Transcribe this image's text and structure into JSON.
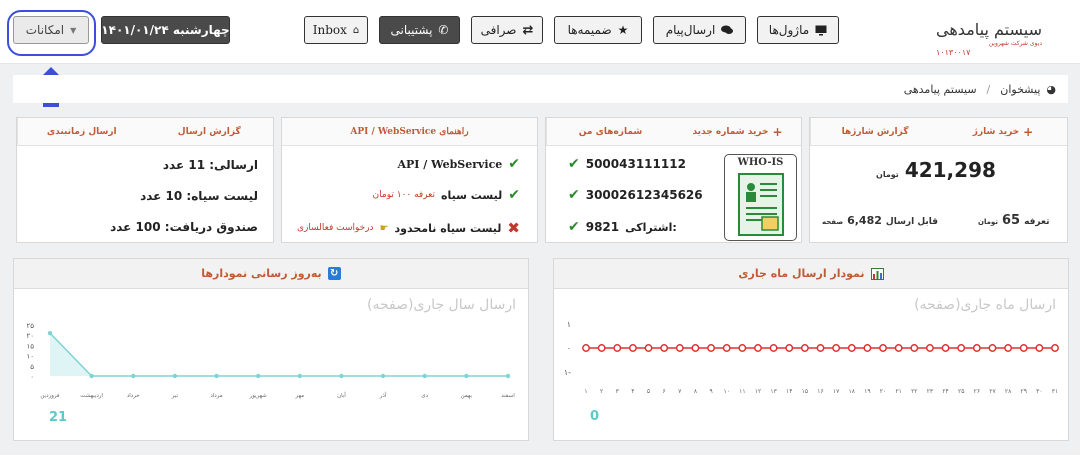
{
  "brand": {
    "title": "سیستم پیامدهی",
    "subtitle": "دیوی شرکت شهروین",
    "code": "۱۰۱۳۰۰۱۷"
  },
  "toolbar": {
    "modules": "ماژول‌ها",
    "send_message": "ارسال‌پیام",
    "attachments": "ضمیمه‌ها",
    "exchange": "صرافی",
    "support": "پشتیبانی",
    "inbox": "Inbox",
    "date": "چهارشنبه ۱۴۰۱/۰۱/۲۴",
    "features": "امکانات"
  },
  "breadcrumb": {
    "home": "پیشخوان",
    "separator": "/",
    "current": "سیستم پیامدهی"
  },
  "charge_card": {
    "tab_buy": "خرید شارژ",
    "tab_report": "گزارش شارژها",
    "balance": "421,298",
    "balance_unit": "تومان",
    "tariff_label": "تعرفه",
    "tariff_value": "65",
    "tariff_unit": "تومان",
    "sendable_label": "قابل ارسال",
    "sendable_value": "6,482",
    "sendable_unit": "صفحه"
  },
  "numbers_card": {
    "tab_buy": "خرید شماره جدید",
    "tab_mine": "شماره‌های من",
    "whois": "WHO-IS",
    "numbers": [
      "500043111112",
      "30002612345626"
    ],
    "shared_label": "اشتراکی:",
    "shared_value": "9821"
  },
  "api_card": {
    "tab": "API / WebService راهنمای",
    "items": [
      "API / WebService",
      "لیست سیاه",
      "لیست سیاه نامحدود"
    ],
    "blacklist_tariff": "تعرفه ۱۰۰ تومان",
    "unlimited_request": "درخواست فعالسازی"
  },
  "report_card": {
    "tab_send": "گزارش ارسال",
    "tab_scheduled": "ارسال زمانبندی",
    "lines": [
      "ارسالی: 11 عدد",
      "لیست سیاه: 10 عدد",
      "صندوق دریافت: 100 عدد"
    ]
  },
  "month_panel": {
    "header": "نمودار ارسال ماه جاری",
    "title": "ارسال ماه جاری(صفحه)",
    "total": "0"
  },
  "year_panel": {
    "header": "به‌روز رسانی نمودارها",
    "title": "ارسال سال جاری(صفحه)",
    "total": "21"
  },
  "colors": {
    "accent": "#c05b35",
    "month_line": "#e03030",
    "year_line": "#7fd3d3",
    "highlight": "#3b4fd8"
  },
  "chart_data": [
    {
      "type": "line",
      "title": "ارسال ماه جاری(صفحه)",
      "x": [
        "۱",
        "۲",
        "۳",
        "۴",
        "۵",
        "۶",
        "۷",
        "۸",
        "۹",
        "۱۰",
        "۱۱",
        "۱۲",
        "۱۳",
        "۱۴",
        "۱۵",
        "۱۶",
        "۱۷",
        "۱۸",
        "۱۹",
        "۲۰",
        "۲۱",
        "۲۲",
        "۲۳",
        "۲۴",
        "۲۵",
        "۲۶",
        "۲۷",
        "۲۸",
        "۲۹",
        "۳۰",
        "۳۱"
      ],
      "values": [
        0,
        0,
        0,
        0,
        0,
        0,
        0,
        0,
        0,
        0,
        0,
        0,
        0,
        0,
        0,
        0,
        0,
        0,
        0,
        0,
        0,
        0,
        0,
        0,
        0,
        0,
        0,
        0,
        0,
        0,
        0
      ],
      "yticks": [
        "۱",
        "۰",
        "۱-"
      ],
      "ylim": [
        -1,
        1
      ]
    },
    {
      "type": "area",
      "title": "ارسال سال جاری(صفحه)",
      "x": [
        "فروردین",
        "اردیبهشت",
        "خرداد",
        "تیر",
        "مرداد",
        "شهریور",
        "مهر",
        "آبان",
        "آذر",
        "دی",
        "بهمن",
        "اسفند"
      ],
      "values": [
        21,
        0,
        0,
        0,
        0,
        0,
        0,
        0,
        0,
        0,
        0,
        0
      ],
      "yticks": [
        "۲۵",
        "۲۰",
        "۱۵",
        "۱۰",
        "۵",
        "۰"
      ],
      "ylim": [
        0,
        25
      ]
    }
  ]
}
